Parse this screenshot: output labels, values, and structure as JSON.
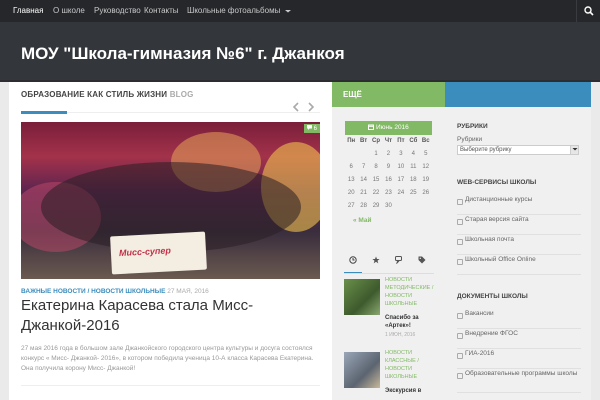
{
  "nav": {
    "items": [
      "Главная",
      "О школе",
      "Руководство",
      "Контакты",
      "Школьные фотоальбомы"
    ],
    "dropdown_icon": "chevron-down-icon",
    "search_icon": "search-icon"
  },
  "site": {
    "title": "МОУ \"Школа-гимназия №6\" г. Джанкоя"
  },
  "content": {
    "section_title": "ОБРАЗОВАНИЕ КАК СТИЛЬ ЖИЗНИ",
    "section_sub": "BLOG",
    "image_badge": "6",
    "image_caption": "Мисс-супер",
    "post": {
      "cat1": "ВАЖНЫЕ НОВОСТИ",
      "sep": "/",
      "cat2": "НОВОСТИ ШКОЛЬНЫЕ",
      "date": "27 МАЯ, 2016",
      "title": "Екатерина Карасева стала Мисс-Джанкой-2016",
      "excerpt": "27 мая 2016 года в большом зале Джанкойского городского центра культуры и досуга состоялся конкурс « Мисс- Джанкой- 2016», в котором победила ученица 10-А класса Карасева Екатерина. Она  получила корону Мисс- Джанкой!"
    }
  },
  "sidebar1": {
    "header": "ЕЩЁ",
    "calendar": {
      "caption": "Июнь 2016",
      "days": [
        "Пн",
        "Вт",
        "Ср",
        "Чт",
        "Пт",
        "Сб",
        "Вс"
      ],
      "weeks": [
        [
          "",
          "",
          "1",
          "2",
          "3",
          "4",
          "5"
        ],
        [
          "6",
          "7",
          "8",
          "9",
          "10",
          "11",
          "12"
        ],
        [
          "13",
          "14",
          "15",
          "16",
          "17",
          "18",
          "19"
        ],
        [
          "20",
          "21",
          "22",
          "23",
          "24",
          "25",
          "26"
        ],
        [
          "27",
          "28",
          "29",
          "30",
          "",
          "",
          ""
        ]
      ],
      "prev": "« Май"
    },
    "posts": [
      {
        "cats": "НОВОСТИ МЕТОДИЧЕСКИЕ / НОВОСТИ ШКОЛЬНЫЕ",
        "title": "Спасибо за «Артек»!",
        "date": "1 ИЮН, 2016"
      },
      {
        "cats": "НОВОСТИ КЛАССНЫЕ / НОВОСТИ ШКОЛЬНЫЕ",
        "title": "Экскурсия в",
        "date": ""
      }
    ]
  },
  "sidebar2": {
    "rubrics_title": "РУБРИКИ",
    "rubrics_label": "Рубрики",
    "rubrics_placeholder": "Выберите рубрику",
    "web_title": "WEB-СЕРВИСЫ ШКОЛЫ",
    "web_links": [
      "Дистанционные курсы",
      "Старая версия сайта",
      "Школьная почта",
      "Школьный Office Online"
    ],
    "docs_title": "ДОКУМЕНТЫ ШКОЛЫ",
    "docs_links": [
      "Вакансии",
      "Внедрение ФГОС",
      "ГИА-2016",
      "Образовательные программы школы"
    ]
  }
}
